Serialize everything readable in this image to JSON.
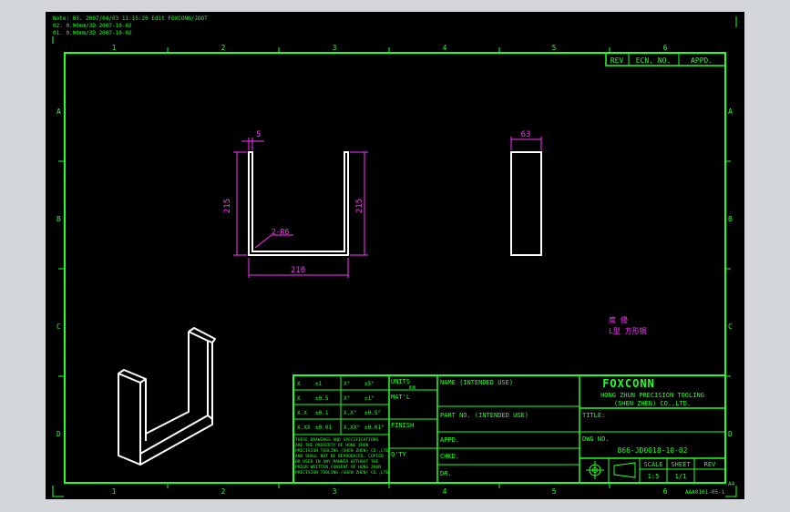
{
  "colors": {
    "background": "#000000",
    "frame": "#22ff22",
    "part": "#ffffff",
    "dimension": "#ff33ff"
  },
  "notes": [
    "Note: 03. 2007/04/03 11:15:20 Edit FOXCONN/JDOT",
    "02. 0.00mm/3D 2007-10-02",
    "01. 0.00mm/3D 2007-10-02"
  ],
  "grid": {
    "columns_top": [
      "1",
      "2",
      "3",
      "4",
      "5",
      "6"
    ],
    "columns_bottom": [
      "1",
      "2",
      "3",
      "4",
      "5",
      "6"
    ],
    "rows_left": [
      "A",
      "B",
      "C",
      "D"
    ],
    "rows_right": [
      "A",
      "B",
      "C",
      "D"
    ]
  },
  "revision_block": {
    "rev": "REV",
    "ecn": "ECN. NO.",
    "appd": "APPD."
  },
  "dimensions": {
    "thickness": "5",
    "left_height": "215",
    "right_height": "215",
    "width": "210",
    "radius": "2-R6",
    "side_width": "63"
  },
  "magenta_note": [
    "度 侵",
    "L型 方形钢"
  ],
  "title_block": {
    "tolerance": [
      {
        "a": "X",
        "b": "±1",
        "c": "X°",
        "d": "±5°"
      },
      {
        "a": "X",
        "b": "±0.5",
        "c": "X°",
        "d": "±1°"
      },
      {
        "a": "X.X",
        "b": "±0.1",
        "c": "X.X°",
        "d": "±0.5°"
      },
      {
        "a": "X.XX",
        "b": "±0.01",
        "c": "X.XX°",
        "d": "±0.01°"
      }
    ],
    "notice": [
      "THESE DRAWINGS AND SPECIFICATIONS",
      "ARE THE PROPERTY OF HONG ZHUN",
      "PRECISION TOOLING (SHEN ZHEN) CO.,LTD.",
      "AND SHALL NOT BE REPRODUCED, COPIED",
      "OR USED IN ANY MANNER WITHOUT THE",
      "PRIOR WRITTEN CONSENT OF HONG ZHUN",
      "PRECISION TOOLING (SHEN ZHEN) CO.,LTD."
    ],
    "units_label": "UNITS",
    "units_value": "mm",
    "matl": "MAT'L",
    "finish": "FINISH",
    "qty": "Q'TY",
    "name": "NAME (INTENDED USE)",
    "part_no": "PART NO. (INTENDED USE)",
    "appd": "APPD.",
    "chkd": "CHKD.",
    "dr": "DR.",
    "brand": "FOXCONN",
    "company_1": "HONG ZHUN PRECISION TOOLING",
    "company_2": "(SHEN ZHEN) CO.,LTD.",
    "title": "TITLE:",
    "dwg_label": "DWG NO.",
    "dwg_no": "866-JD0018-10-02",
    "scale_label": "SCALE",
    "scale_value": "1:5",
    "sheet_label": "SHEET",
    "sheet_value": "1/1",
    "rev_label": "REV"
  },
  "corner_code": "A4",
  "form_code": "AAA0101-05-1"
}
